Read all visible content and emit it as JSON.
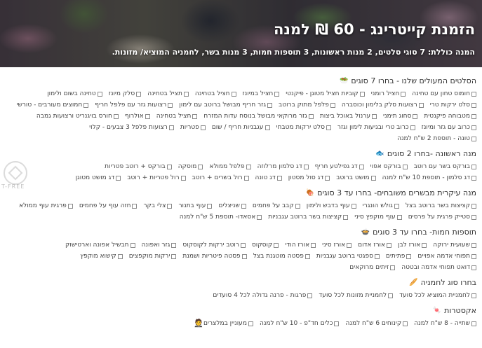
{
  "header": {
    "title": "הזמנת קייטרינג - 60 ₪ למנה",
    "subtitle": "המנה כוללת: 7 סוגי סלטים, 2 מנות ראשונות, 3 תוספות חמות, 3 מנות בשר, לחמניה המוציא/ מזונות."
  },
  "watermark": {
    "text": "T-FREE"
  },
  "sections": [
    {
      "title": "הסלטים המעולים שלנו - בחרו 7 סוגים",
      "icon": "salad-icon",
      "options": [
        "חומוס טחון עם טחינה",
        "חציל רומני",
        "קוביות חציל מטוגן - פיקנטי",
        "חציל במיונז",
        "חציל בטחינה",
        "תציל בטחינה",
        "סלק מיונז",
        "טחינה בשום ולימון",
        "סלט ירקות טרי",
        "רצועות סלק בלימון וכוסברה",
        "פלפל מתוק ברוטב",
        "גזר חריף מבושל ברוטב עם לימון",
        "רצועות גזר עם פלפל חריף",
        "חמוצים מעורבים - טורשי",
        "מטבוחה פיקנטית",
        "סחוג תימני",
        "ערנול באוכל ביצות",
        "גזר מרוקאי מבושל בנוסח עדות המזרח",
        "חציל בטחינה",
        "אולרוף",
        "חורס בויגנריט ורצועות גמבה",
        "כרוב עם גזר ומיונז",
        "כרוב טרי ובגיעות לימון וגזר",
        "סלט ירקות מטבחי",
        "עגבניות חריף / שום",
        "פטריות",
        "רצועות פלפל 3 צבעים - קלוי",
        "טונה - תוספת 2 ש\"ח למנה"
      ]
    },
    {
      "title": "מנה ראשונה -בחרו 2 סוגים",
      "icon": "fish-icon",
      "options": [
        "בורקס בשר עם רוטב",
        "בורקס אפוי",
        "דג גפילטע חריף",
        "דג סלמון מרלוזה",
        "פלפל ממולא",
        "מוסקה",
        "בורקס + רוטב פטריות",
        "דג סלמון - תוספת 10 ש\"ח למנה",
        "מושט ברוטב",
        "דג סול מסטון",
        "דג טונה",
        "רול בשרים + רוטב",
        "רול פטריות + רוטב",
        "דג מושט מטוגן"
      ]
    },
    {
      "title": "מנה עיקרית מבשרים משובחים- בחרו עד 3 סוגים",
      "icon": "meat-icon",
      "options": [
        "קציצות בשר ברוטב בצל",
        "גולש הונגרי",
        "עוף בדבש ולימון",
        "קבב על פחמים",
        "שניצלים",
        "עוף בתנור",
        "צלי בקר",
        "חזה עוף על פחמים",
        "פרגית עוף ממולא",
        "סטייק פרגית על פרסים",
        "עוף מוקפץ סיני",
        "קציצות בשר ברוטב עגבניות",
        "אסאדו- תוספת 5 ש\"ח למנה"
      ]
    },
    {
      "title": "תוספות חמות- בחרו עד 3 סוגים",
      "icon": "pot-icon",
      "options": [
        "שעועית ירוקה",
        "אורז לבן",
        "אורז אדום",
        "אורז סיני",
        "אורז הודי",
        "קוסקוס",
        "רוטב ירקות לקוסקוס",
        "גזר ואפונה",
        "חבשיל אפונה וארטישוק",
        "תפוחי אדמה אפויים",
        "פתיתים",
        "ספגטי ברוטב עגבניות",
        "פסטה מוטגנת בצל",
        "פסטה פיטריות ושמנת",
        "ירקות מוקפצים",
        "קישוא מוקפץ",
        "דואט תפוחי אדמה ובטטה",
        "זיתים מרוקאים"
      ]
    },
    {
      "title": "בחרו סוג לחמניה",
      "icon": "bread-icon",
      "options": [
        "לחמניית המוציא לכל סועד",
        "לחמניית מזונות לכל סועד",
        "פרגות - פרנה גדולה לכל 4 סועדים"
      ]
    },
    {
      "title": "אקסטרות",
      "icon": "candy-icon",
      "options": [
        "שתייה - 8 ש\"ח למנה",
        "קינוחים 6 ש\"ח למנה",
        "כלים חד\"פ - 10 ש\"ח למנה"
      ],
      "tail_label": "מעוניין במלצרים",
      "tail_icon": "waiter-icon"
    }
  ]
}
